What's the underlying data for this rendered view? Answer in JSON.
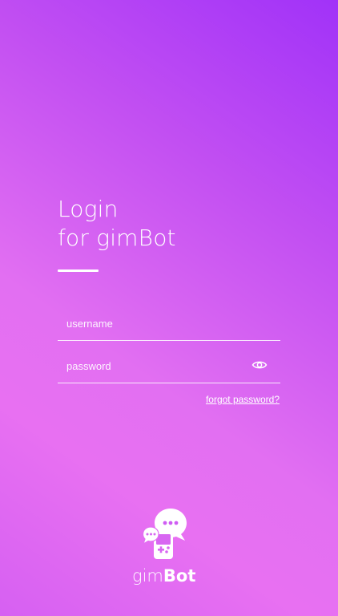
{
  "login": {
    "title_line1": "Login",
    "title_line2": "for gimBot"
  },
  "form": {
    "username_placeholder": "username",
    "password_placeholder": "password",
    "forgot_password": "forgot password?"
  },
  "icons": {
    "password_toggle": "eye-icon",
    "logo": "gimbot-logo-icon"
  },
  "brand": {
    "name_light": "gim",
    "name_bold": "Bot"
  },
  "colors": {
    "gradient_top": "#a132f8",
    "gradient_bottom": "#e870f2",
    "text": "#ffffff"
  }
}
